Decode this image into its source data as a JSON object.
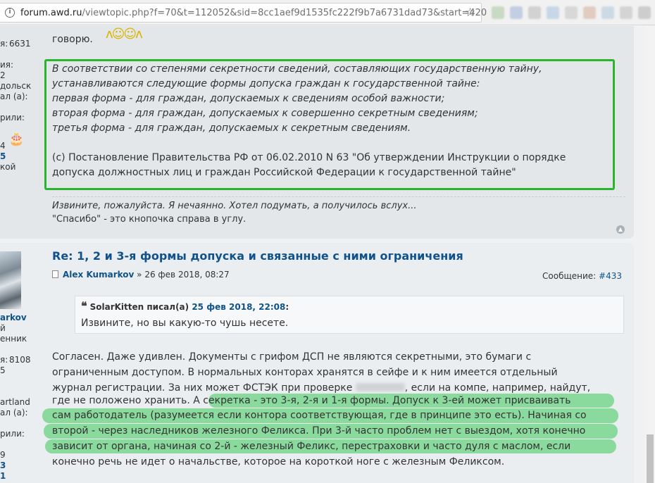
{
  "browser": {
    "url_domain": "forum.awd.ru",
    "url_path": "/viewtopic.php?f=70&t=112052&sid=8cc1aef9d1535fc222f9b7a6731dad73&start=420"
  },
  "left_profile_1": {
    "posts_value": "6631",
    "line2": "ия:",
    "line3": "2",
    "line4": "дольск",
    "line5": "ал (а):",
    "line6": "рили:",
    "line7": "4",
    "line8": "5",
    "line9": "кой",
    "posts_label": "я:"
  },
  "post1": {
    "intro": "говорю.",
    "quote_lines": [
      "В соответствии со степенями секретности сведений, составляющих государственную тайну,",
      "устанавливаются следующие формы допуска граждан к государственной тайне:",
      "первая форма - для граждан, допускаемых к сведениям особой важности;",
      "вторая форма - для граждан, допускаемых к совершенно секретным сведениям;",
      "третья форма - для граждан, допускаемых к секретным сведениям."
    ],
    "source_lines": [
      "(c) Постановление Правительства РФ от 06.02.2010 N 63 \"Об утверждении Инструкции о порядке",
      "допуска должностных лиц и граждан Российской Федерации к государственной тайне\""
    ],
    "signature_line1": "Извините, пожалуйста. Я нечаянно. Хотел подумать, а получилось вслух...",
    "signature_line2": "\"Спасибо\" - это кнопочка справа в углу."
  },
  "left_profile_2": {
    "name": "arkov",
    "rank1": "й",
    "rank2": "енник",
    "posts_label": "я:",
    "posts_value": "8108",
    "l1": "5",
    "l2": "artland",
    "l3": "ал (а):",
    "l4": "рили:",
    "l5": "9",
    "l6": "3",
    "l7": "1"
  },
  "post2": {
    "title": "Re: 1, 2 и 3-я формы допуска и связанные с ними ограничения",
    "author": "Alex Kumarkov",
    "date": "» 26 фев 2018, 08:27",
    "msg_label": "Сообщение:",
    "msg_number": "#433",
    "quote_author": "SolarKitten писал(а)",
    "quote_date": "25 фев 2018, 22:08",
    "quote_colon": ":",
    "quote_text": "Извините, но вы какую-то чушь несете.",
    "body_lines": [
      "Согласен. Даже удивлен. Документы с грифом ДСП не являются секретными, это бумаги с",
      "ограниченным доступом. В нормальных конторах хранятся в сейфе и к ним имеется отдельный",
      "журнал регистрации. За них может ФСТЭК при проверке",
      ", если на компе, например, найдут,",
      "где не положено хранить. А",
      "секретка - это 3-я, 2-я и 1-я формы. Допуск к 3-ей может присваивать",
      "сам работодатель (разумеется если контора соответствующая, где в принципе это есть). Начиная со",
      "второй - через наследников железного Феликса. При 3-й часто проблем нет с выездом, хотя конечно",
      "зависит от органа, начиная со 2-й - железный Феликс, перестраховки и часто дуля с маслом, если",
      "конечно речь не идет о начальстве, которое на короткой ноге с железным Феликсом."
    ]
  }
}
